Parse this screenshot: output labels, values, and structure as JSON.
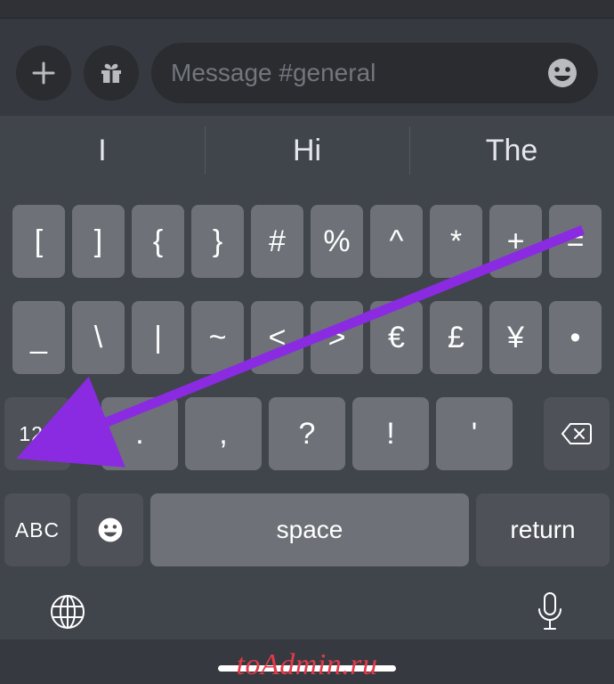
{
  "input": {
    "placeholder": "Message #general"
  },
  "suggestions": [
    "I",
    "Hi",
    "The"
  ],
  "rows": {
    "r1": [
      "[",
      "]",
      "{",
      "}",
      "#",
      "%",
      "^",
      "*",
      "+",
      "="
    ],
    "r2": [
      "_",
      "\\",
      "|",
      "~",
      "<",
      ">",
      "€",
      "£",
      "¥",
      "•"
    ],
    "r3_mode": "123",
    "r3": [
      ".",
      ",",
      "?",
      "!",
      "'"
    ],
    "r4_abc": "ABC",
    "r4_space": "space",
    "r4_return": "return"
  },
  "watermark": "toAdmin.ru",
  "arrow": {
    "color": "#8a2be2"
  }
}
